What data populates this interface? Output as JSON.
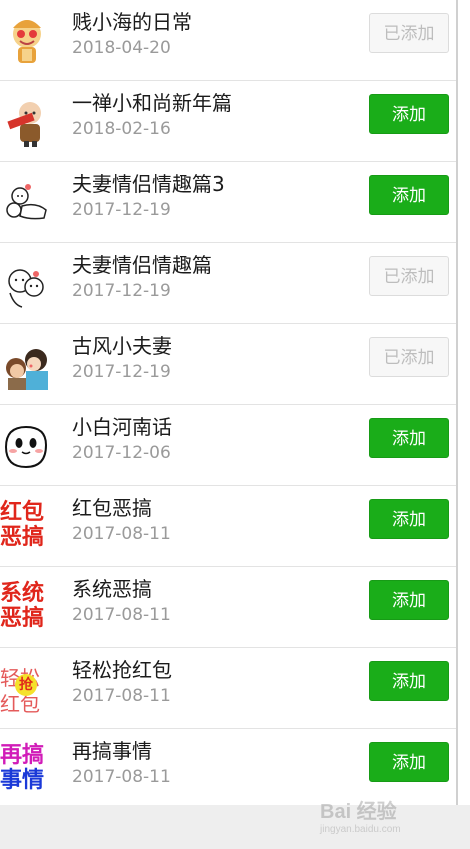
{
  "sticker_list": {
    "items": [
      {
        "title": "贱小海的日常",
        "date": "2018-04-20",
        "button": "已添加",
        "added": true,
        "icon": "cartoon-monk-hearts-icon"
      },
      {
        "title": "一禅小和尚新年篇",
        "date": "2018-02-16",
        "button": "添加",
        "added": false,
        "icon": "little-monk-scroll-icon"
      },
      {
        "title": "夫妻情侣情趣篇3",
        "date": "2017-12-19",
        "button": "添加",
        "added": false,
        "icon": "couple-doodle-icon"
      },
      {
        "title": "夫妻情侣情趣篇",
        "date": "2017-12-19",
        "button": "已添加",
        "added": true,
        "icon": "couple-sketch-icon"
      },
      {
        "title": "古风小夫妻",
        "date": "2017-12-19",
        "button": "已添加",
        "added": true,
        "icon": "ancient-couple-icon"
      },
      {
        "title": "小白河南话",
        "date": "2017-12-06",
        "button": "添加",
        "added": false,
        "icon": "white-blob-face-icon"
      },
      {
        "title": "红包恶搞",
        "date": "2017-08-11",
        "button": "添加",
        "added": false,
        "icon": "red-envelope-text-icon",
        "icon_text": [
          "红包",
          "恶搞"
        ]
      },
      {
        "title": "系统恶搞",
        "date": "2017-08-11",
        "button": "添加",
        "added": false,
        "icon": "system-prank-text-icon",
        "icon_text": [
          "系统",
          "恶搞"
        ]
      },
      {
        "title": "轻松抢红包",
        "date": "2017-08-11",
        "button": "添加",
        "added": false,
        "icon": "grab-red-envelope-text-icon",
        "icon_text": [
          "轻松",
          "抢",
          "红包"
        ]
      },
      {
        "title": "再搞事情",
        "date": "2017-08-11",
        "button": "添加",
        "added": false,
        "icon": "colorful-text-icon",
        "icon_text": [
          "再搞",
          "事情"
        ]
      }
    ]
  },
  "colors": {
    "add_button": "#1aad19",
    "added_button_bg": "#f7f7f7",
    "added_button_text": "#bdbdbd",
    "title_text": "#1b1b1b",
    "date_text": "#9a9a9a"
  },
  "watermark": {
    "text": "Bai 经验",
    "subtext": "jingyan.baidu.com"
  }
}
